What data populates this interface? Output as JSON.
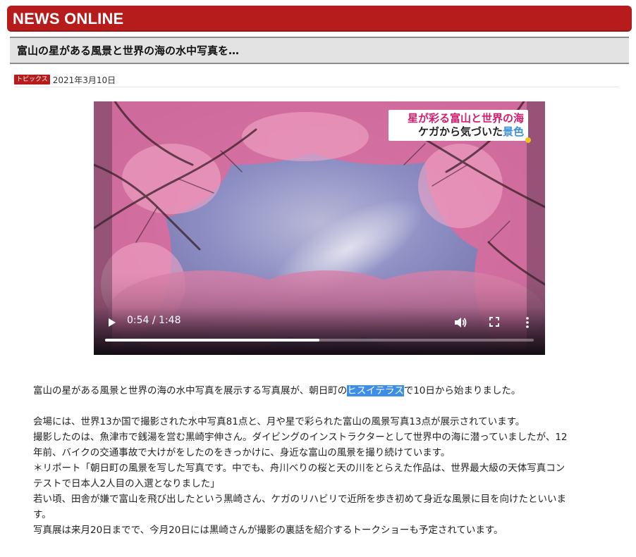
{
  "site": {
    "title": "NEWS ONLINE",
    "accent_color": "#b71c1c"
  },
  "article": {
    "title": "富山の星がある風景と世界の海の水中写真を…",
    "category": "トピックス",
    "date": "2021年3月10日"
  },
  "video": {
    "caption_line1": "星が彩る富山と世界の海",
    "caption_line2_prefix": "ケガから気づいた",
    "caption_line2_highlight": "景色",
    "current_time": "0:54",
    "duration": "1:48",
    "time_display": "0:54 / 1:48",
    "progress_fraction": 0.5,
    "icons": [
      "play-icon",
      "volume-icon",
      "fullscreen-icon",
      "more-options-icon"
    ]
  },
  "body": {
    "p1_before": "富山の星がある風景と世界の海の水中写真を展示する写真展が、朝日町の",
    "p1_selected": "ヒスイテラス",
    "p1_after": "で10日から始まりました。",
    "lines": [
      "会場には、世界13か国で撮影された水中写真81点と、月や星で彩られた富山の風景写真13点が展示されています。",
      "撮影したのは、魚津市で銭湯を営む黒崎宇伸さん。ダイビングのインストラクターとして世界中の海に潜っていましたが、12",
      "年前、バイクの交通事故で大けがをしたのをきっかけに、身近な富山の風景を撮り続けています。",
      "＊リポート「朝日町の風景を写した写真です。中でも、舟川べりの桜と天の川をとらえた作品は、世界最大級の天体写真コン",
      "テストで日本人2人目の入選となりました」",
      "若い頃、田舎が嫌で富山を飛び出したという黒崎さん、ケガのリハビリで近所を歩き初めて身近な風景に目を向けたといいま",
      "す。",
      "写真展は来月20日までで、今月20日には黒崎さんが撮影の裏話を紹介するトークショーも予定されています。"
    ]
  }
}
